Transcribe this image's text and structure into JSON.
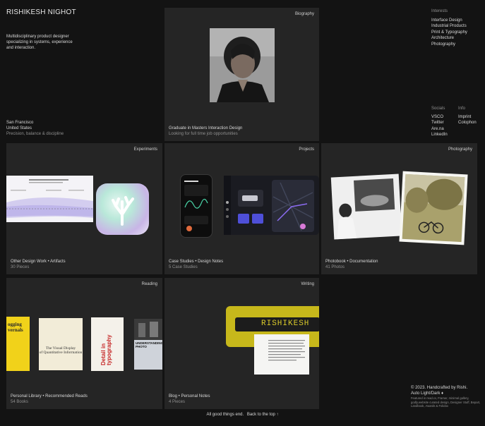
{
  "header": {
    "name": "RISHIKESH NIGHOT",
    "tagline": "Multidisciplinary product designer specializing in systems, experience and interaction."
  },
  "location": {
    "city": "San Francisco",
    "country": "United States",
    "motto": "Precision, balance & discipline"
  },
  "biography": {
    "tag": "Biography",
    "line1": "Graduate in Masters Interaction Design",
    "line2": "Looking for full time job opportunities"
  },
  "interests": {
    "heading": "Interests",
    "items": [
      "Interface Design",
      "Industrial Products",
      "Print & Typography",
      "Architecture",
      "Photography"
    ]
  },
  "socials": {
    "heading": "Socials",
    "items": [
      "VSCO",
      "Twitter",
      "Are.na",
      "LinkedIn"
    ]
  },
  "info": {
    "heading": "Info",
    "items": [
      "Imprint",
      "Colophon"
    ]
  },
  "cards": {
    "experiments": {
      "tag": "Experiments",
      "title": "Other Design Work • Artifacts",
      "count": "30 Pieces"
    },
    "projects": {
      "tag": "Projects",
      "title": "Case Studies • Design Notes",
      "count": "5 Case Studies"
    },
    "photography": {
      "tag": "Photography",
      "title": "Photobook • Documentation",
      "count": "41 Photos"
    },
    "reading": {
      "tag": "Reading",
      "title": "Personal Library • Recommended Reads",
      "count": "54 Books"
    },
    "writing": {
      "tag": "Writing",
      "title": "Blog • Personal Notes",
      "count": "4 Pieces",
      "sign_text": "RISHIKESH"
    }
  },
  "books": {
    "b1": "ogging vernals",
    "b2a": "The Visual Display",
    "b2b": "of Quantitative Information",
    "b3": "Detail in typography",
    "b4": "UNDERSTANDING PHOTO"
  },
  "footer": {
    "copyright": "© 2023. Handcrafted by Rishi.",
    "theme": "Auto Light/Dark ♦",
    "featured": "Featured in read.cv, Framer, minimal gallery, godly.website curated design, Designer Stuff, Bepart, Landbook, Awards & Folidox",
    "end_text": "All good things end.",
    "back_top": "Back to the top ↑"
  },
  "colors": {
    "bg": "#131313",
    "card": "#252525",
    "text": "#d8d8d8",
    "muted": "#8f8f8f",
    "writing_yellow": "#c7b81b"
  }
}
